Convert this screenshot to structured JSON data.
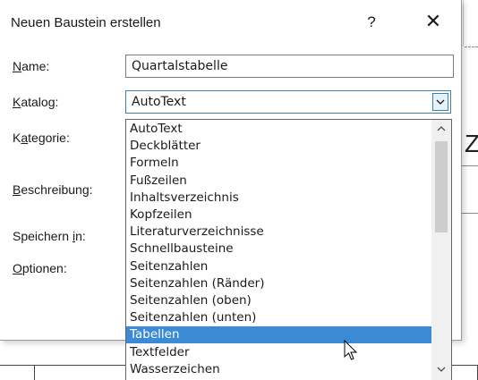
{
  "dialog": {
    "title": "Neuen Baustein erstellen",
    "help_label": "?",
    "close_label": "✕"
  },
  "form": {
    "name_label_accel": "N",
    "name_label_rest": "ame:",
    "name_value": "Quartalstabelle",
    "katalog_label_accel": "K",
    "katalog_label_rest": "atalog:",
    "katalog_value": "AutoText",
    "kategorie_label_pre": "K",
    "kategorie_label_accel": "a",
    "kategorie_label_rest": "tegorie:",
    "beschreibung_label_accel": "B",
    "beschreibung_label_rest": "eschreibung:",
    "speichern_label_pre": "Speichern ",
    "speichern_label_accel": "i",
    "speichern_label_rest": "n:",
    "optionen_label_accel": "O",
    "optionen_label_rest": "ptionen:"
  },
  "dropdown": {
    "items": [
      "AutoText",
      "Deckblätter",
      "Formeln",
      "Fußzeilen",
      "Inhaltsverzeichnis",
      "Kopfzeilen",
      "Literaturverzeichnisse",
      "Schnellbausteine",
      "Seitenzahlen",
      "Seitenzahlen (Ränder)",
      "Seitenzahlen (oben)",
      "Seitenzahlen (unten)",
      "Tabellen",
      "Textfelder",
      "Wasserzeichen"
    ],
    "selected": "Tabellen"
  },
  "background": {
    "partial_text": "Z"
  },
  "colors": {
    "selection": "#3a8ad6",
    "combo_border": "#3c7fb1"
  }
}
